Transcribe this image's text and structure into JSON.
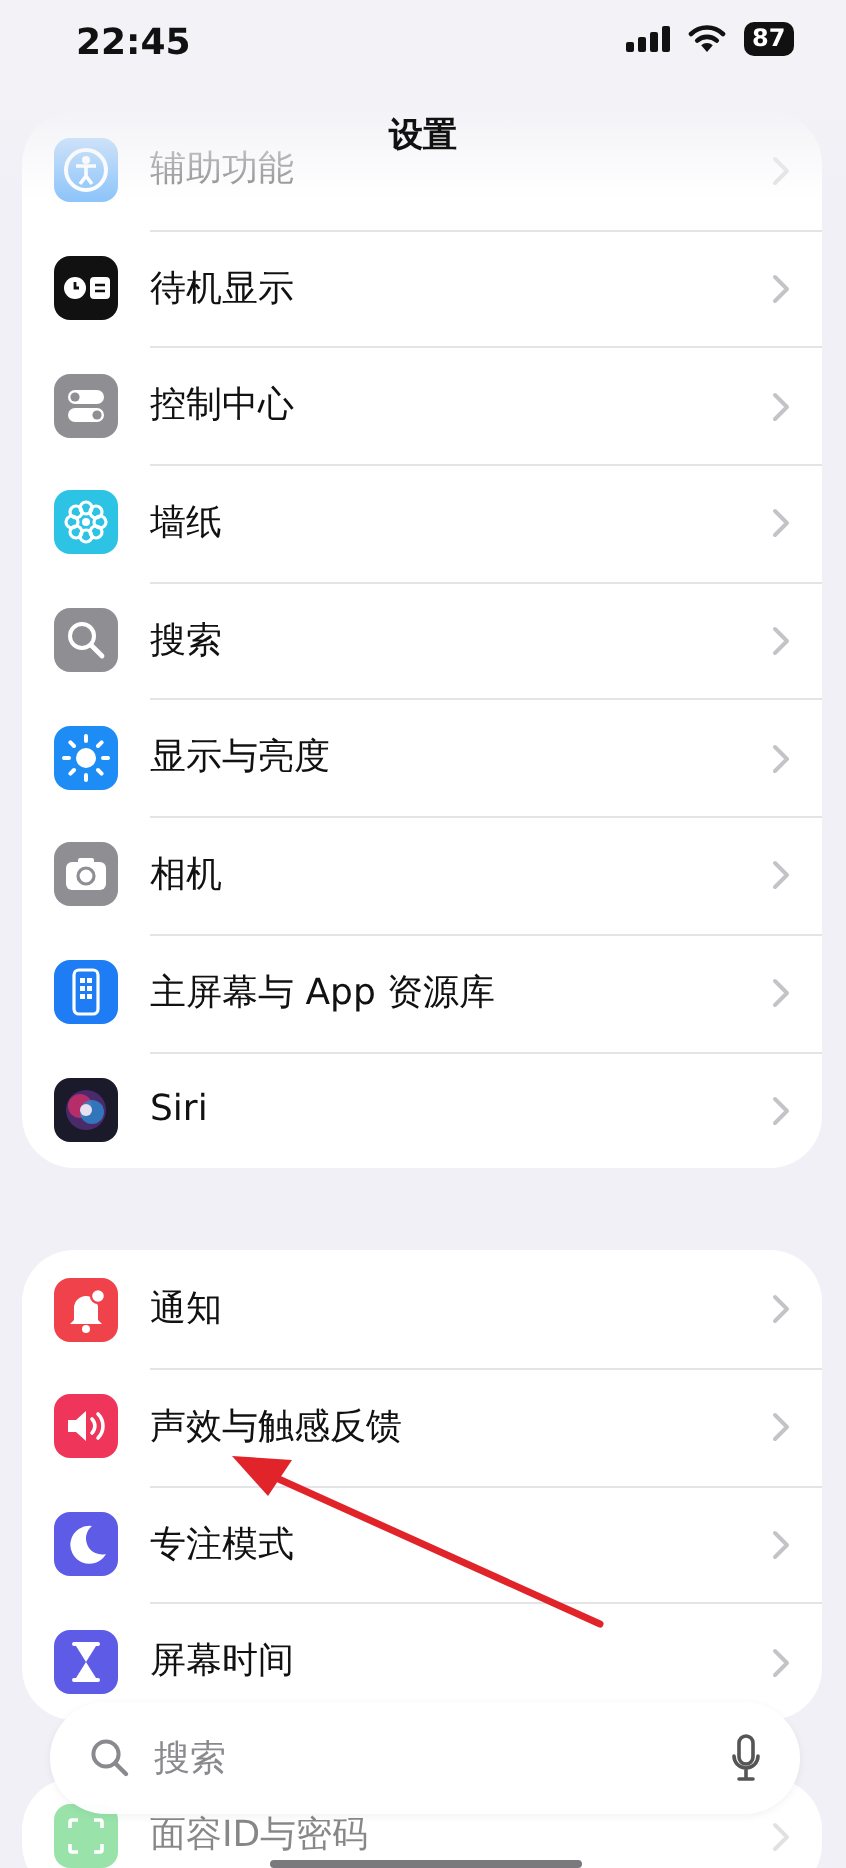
{
  "status_bar": {
    "time": "22:45",
    "battery": "87"
  },
  "title": "设置",
  "groups": [
    {
      "items": [
        {
          "label": "辅助功能",
          "kind": "accessibility",
          "dimmed": true
        },
        {
          "label": "待机显示",
          "kind": "standby",
          "dimmed": false
        },
        {
          "label": "控制中心",
          "kind": "control",
          "dimmed": false
        },
        {
          "label": "墙纸",
          "kind": "wallpaper",
          "dimmed": false
        },
        {
          "label": "搜索",
          "kind": "search",
          "dimmed": false
        },
        {
          "label": "显示与亮度",
          "kind": "display",
          "dimmed": false
        },
        {
          "label": "相机",
          "kind": "camera",
          "dimmed": false
        },
        {
          "label": "主屏幕与 App 资源库",
          "kind": "homescreen",
          "dimmed": false
        },
        {
          "label": "Siri",
          "kind": "siri",
          "dimmed": false
        }
      ]
    },
    {
      "items": [
        {
          "label": "通知",
          "kind": "notifications",
          "dimmed": false
        },
        {
          "label": "声效与触感反馈",
          "kind": "sounds",
          "dimmed": false
        },
        {
          "label": "专注模式",
          "kind": "focus",
          "dimmed": false
        },
        {
          "label": "屏幕时间",
          "kind": "screentime",
          "dimmed": false
        }
      ]
    },
    {
      "items": [
        {
          "label": "面容ID与密码",
          "kind": "faceid",
          "dimmed": true
        }
      ]
    }
  ],
  "search": {
    "placeholder": "搜索"
  }
}
